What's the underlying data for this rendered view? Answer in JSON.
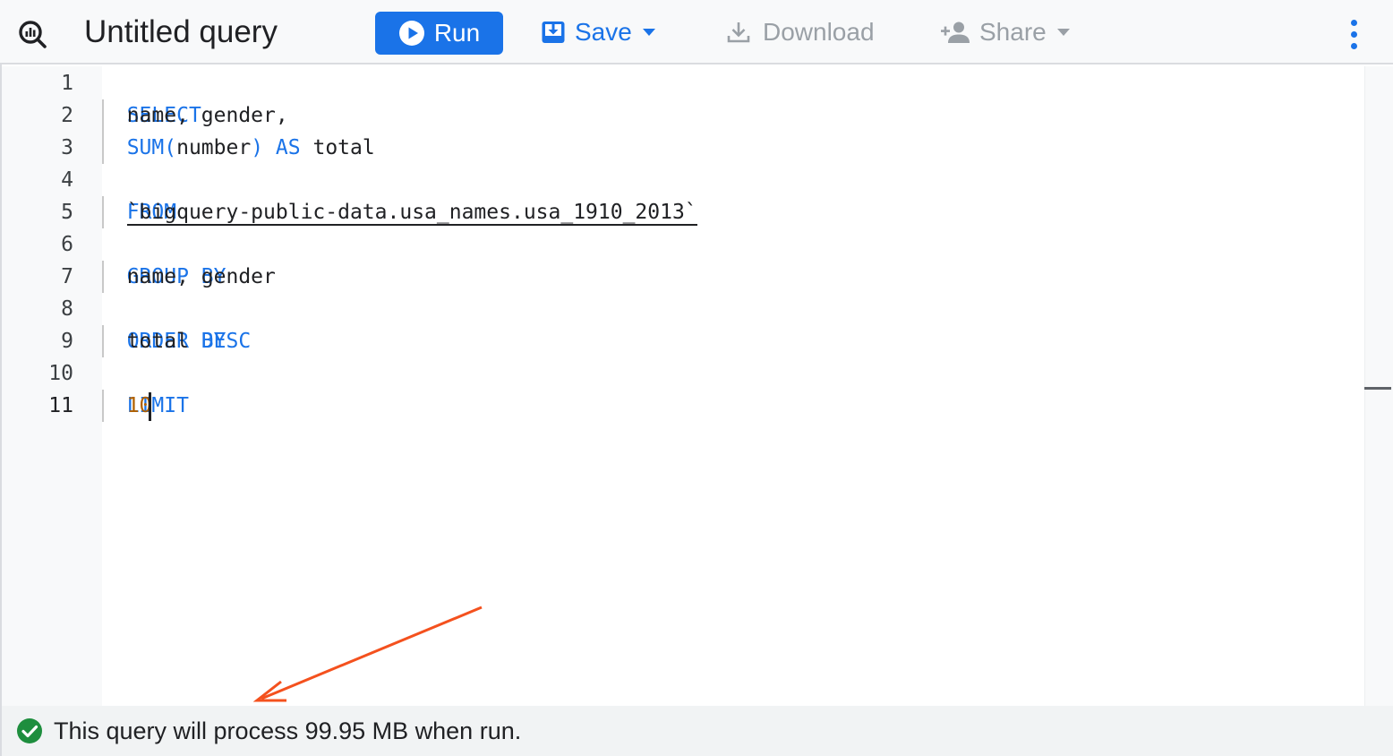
{
  "toolbar": {
    "app_icon": "bigquery-icon",
    "title": "Untitled query",
    "run_label": "Run",
    "save_label": "Save",
    "download_label": "Download",
    "share_label": "Share",
    "more_icon": "more-vert-icon"
  },
  "editor": {
    "line_numbers": [
      "1",
      "2",
      "3",
      "4",
      "5",
      "6",
      "7",
      "8",
      "9",
      "10",
      "11"
    ],
    "lines": [
      {
        "keyword": "SELECT"
      },
      {
        "text": "name, gender,"
      },
      {
        "fn": "SUM(",
        "arg": "number",
        "close": ")",
        "as": "AS",
        "alias": "total"
      },
      {
        "keyword": "FROM"
      },
      {
        "table": "`bigquery-public-data.usa_names.usa_1910_2013`"
      },
      {
        "keyword": "GROUP BY"
      },
      {
        "text": "name, gender"
      },
      {
        "keyword": "ORDER BY"
      },
      {
        "text": "total",
        "kw": "DESC"
      },
      {
        "keyword": "LIMIT"
      },
      {
        "number": "10"
      }
    ]
  },
  "status": {
    "icon": "check-circle-icon",
    "message": "This query will process 99.95 MB when run."
  },
  "colors": {
    "accent": "#1a73e8",
    "keyword": "#1a73e8",
    "number": "#b06000",
    "success": "#1e8e3e",
    "annotation_arrow": "#f4511e",
    "disabled": "#9aa0a6"
  }
}
